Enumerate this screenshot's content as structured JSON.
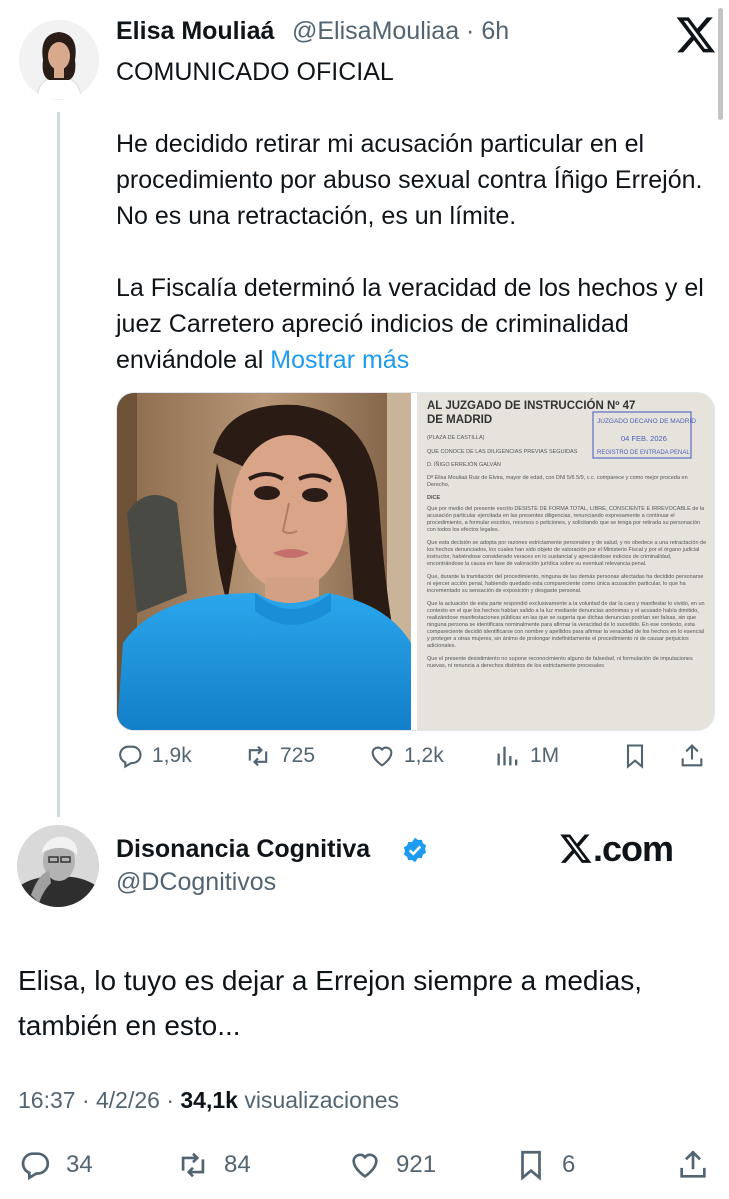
{
  "tweet": {
    "author_name": "Elisa Mouliaá",
    "author_handle_time": "@ElisaMouliaa · 6h",
    "heading": "COMUNICADO OFICIAL",
    "paragraph1": "He decidido retirar mi acusación particular en el procedimiento por abuso sexual contra Íñigo Errejón. No es una retractación, es un límite.",
    "paragraph2": "La Fiscalía determinó la veracidad de los hechos y el juez Carretero apreció indicios de criminalidad enviándole al ",
    "show_more": "Mostrar más",
    "replies": "1,9k",
    "retweets": "725",
    "likes": "1,2k",
    "views": "1M"
  },
  "document": {
    "title_line1": "AL JUZGADO DE INSTRUCCIÓN Nº 47",
    "title_line2": "DE MADRID",
    "stamp_line1": "JUZGADO DECANO DE MADRID",
    "stamp_date": "04 FEB. 2026",
    "stamp_line3": "REGISTRO DE ENTRADA PENAL",
    "place": "(PLAZA DE CASTILLA)",
    "procedure": "QUE CONOCE DE LAS DILIGENCIAS PREVIAS SEGUIDAS",
    "accused": "D. ÍÑIGO ERREJÓN GALVÁN",
    "intro": "Dª Elisa Mouliaá Ruiz de Elvira, mayor de edad, con DNI 5/6 5/9, c.c. comparece y como mejor proceda en Derecho,",
    "dice": "DICE",
    "body1": "Que por medio del presente escrito DESISTE DE FORMA TOTAL, LIBRE, CONSCIENTE E IRREVOCABLE de la acusación particular ejercitada en las presentes diligencias, renunciando expresamente a continuar el procedimiento, a formular escritos, recursos o peticiones, y solicitando que se tenga por retirada su personación con todos los efectos legales.",
    "body2": "Que esta decisión se adopta por razones estrictamente personales y de salud, y no obedece a una retractación de los hechos denunciados, los cuales han sido objeto de valoración por el Ministerio Fiscal y por el órgano judicial instructor, habiéndose considerado veraces en lo sustancial y apreciándose indicios de criminalidad, encontrándose la causa en fase de valoración jurídica sobre su eventual relevancia penal.",
    "body3": "Que, durante la tramitación del procedimiento, ninguna de las demás personas afectadas ha decidido personarse ni ejercer acción penal, habiendo quedado esta compareciente como única acusación particular, lo que ha incrementado su sensación de exposición y desgaste personal.",
    "body4": "Que la actuación de esta parte respondió exclusivamente a la voluntad de dar la cara y manifestar lo vivido, en un contexto en el que los hechos habían salido a la luz mediante denuncias anónimas y el acusado había dimitido, realizándose manifestaciones públicas en las que se sugería que dichas denuncias podrían ser falsas, sin que ninguna persona se identificara nominalmente para afirmar la veracidad de lo sucedido. En ese contexto, esta compareciente decidió identificarse con nombre y apellidos para afirmar la veracidad de los hechos en lo esencial y proteger a otras mujeres, sin ánimo de prolongar indefinidamente el procedimiento ni de causar perjuicios adicionales.",
    "body5": "Que el presente desistimiento no supone reconocimiento alguno de falsedad, ni formulación de imputaciones nuevas, ni renuncia a derechos distintos de los estrictamente procesales"
  },
  "reply": {
    "author_name": "Disonancia Cognitiva",
    "author_handle": "@DCognitivos",
    "watermark": ".com",
    "text": "Elisa, lo tuyo es dejar a Errejon siempre a medias, también en esto...",
    "time_date": "16:37 · 4/2/26 · ",
    "views_count": "34,1k",
    "views_label": " visualizaciones",
    "replies": "34",
    "retweets": "84",
    "likes": "921",
    "bookmarks": "6"
  },
  "icons": [
    "x-logo-icon",
    "reply-icon",
    "retweet-icon",
    "like-icon",
    "views-icon",
    "bookmark-icon",
    "share-icon",
    "verified-badge-icon"
  ],
  "colors": {
    "link": "#1d9bf0",
    "muted": "#536471",
    "verified": "#1d9bf0",
    "sweater": "#1c8fd8"
  }
}
